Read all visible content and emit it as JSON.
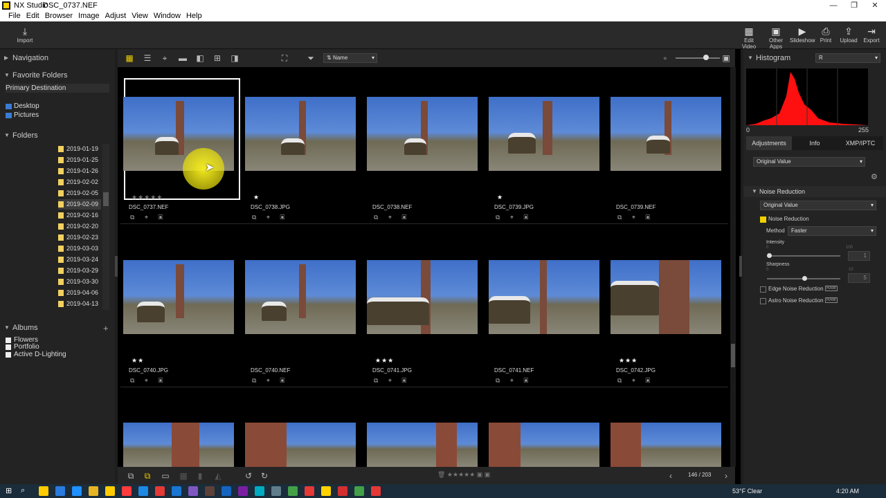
{
  "window": {
    "app": "NX Studio",
    "file": "DSC_0737.NEF"
  },
  "menu": [
    "File",
    "Edit",
    "Browser",
    "Image",
    "Adjust",
    "View",
    "Window",
    "Help"
  ],
  "toolbar": {
    "import": "Import",
    "right": [
      "Edit Video",
      "Other Apps",
      "Slideshow",
      "Print",
      "Upload",
      "Export"
    ]
  },
  "left": {
    "navigation": "Navigation",
    "favorites": "Favorite Folders",
    "primary": "Primary Destination",
    "desktop": "Desktop",
    "pictures": "Pictures",
    "folders_title": "Folders",
    "folders": [
      "2019-01-19",
      "2019-01-25",
      "2019-01-26",
      "2019-02-02",
      "2019-02-05",
      "2019-02-09",
      "2019-02-16",
      "2019-02-20",
      "2019-02-23",
      "2019-03-03",
      "2019-03-24",
      "2019-03-29",
      "2019-03-30",
      "2019-04-06",
      "2019-04-13"
    ],
    "albums_title": "Albums",
    "albums": [
      "Flowers",
      "Portfolio",
      "Active D-Lighting"
    ]
  },
  "grid": {
    "sort": "Name",
    "row1": [
      {
        "name": "DSC_0737.NEF",
        "stars": "★★★★★"
      },
      {
        "name": "DSC_0738.JPG",
        "stars": "★"
      },
      {
        "name": "DSC_0738.NEF",
        "stars": ""
      },
      {
        "name": "DSC_0739.JPG",
        "stars": "★"
      },
      {
        "name": "DSC_0739.NEF",
        "stars": ""
      }
    ],
    "row2": [
      {
        "name": "DSC_0740.JPG",
        "stars": "★★"
      },
      {
        "name": "DSC_0740.NEF",
        "stars": ""
      },
      {
        "name": "DSC_0741.JPG",
        "stars": "★★★"
      },
      {
        "name": "DSC_0741.NEF",
        "stars": ""
      },
      {
        "name": "DSC_0742.JPG",
        "stars": "★★★"
      }
    ],
    "page": "146 / 203"
  },
  "right": {
    "histogram": "Histogram",
    "channel": "R",
    "hmin": "0",
    "hmax": "255",
    "tabs": [
      "Adjustments",
      "Info",
      "XMP/IPTC"
    ],
    "preset": "Original Value",
    "nr_title": "Noise Reduction",
    "nr_preset": "Original Value",
    "nr_check": "Noise Reduction",
    "method_label": "Method",
    "method": "Faster",
    "intensity": "Intensity",
    "i_min": "0",
    "i_max": "100",
    "i_val": "1",
    "sharpness": "Sharpness",
    "s_min": "0",
    "s_max": "10",
    "s_val": "5",
    "edge": "Edge Noise Reduction",
    "astro": "Astro Noise Reduction",
    "raw": "RAW"
  },
  "taskbar": {
    "weather": "53°F  Clear",
    "time": "4:20 AM"
  }
}
